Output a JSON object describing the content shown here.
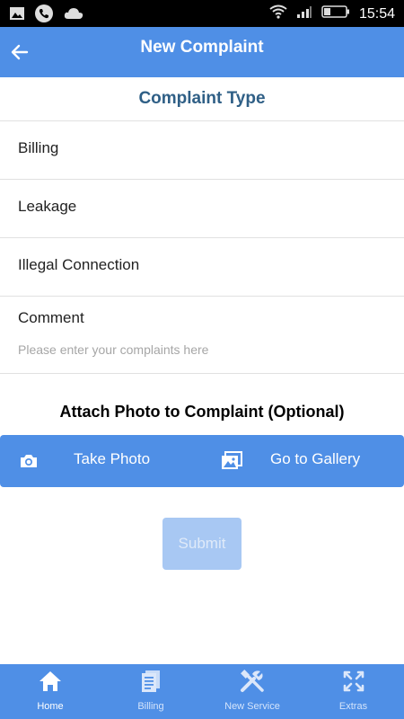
{
  "status": {
    "time": "15:54"
  },
  "appbar": {
    "title": "New Complaint"
  },
  "section": {
    "title": "Complaint Type"
  },
  "types": [
    "Billing",
    "Leakage",
    "Illegal Connection"
  ],
  "comment": {
    "label": "Comment",
    "placeholder": "Please enter your complaints here",
    "value": ""
  },
  "attach": {
    "title": "Attach Photo to Complaint (Optional)",
    "take_photo": "Take Photo",
    "gallery": "Go to Gallery"
  },
  "submit": {
    "label": "Submit"
  },
  "nav": {
    "home": "Home",
    "billing": "Billing",
    "new_service": "New Service",
    "extras": "Extras",
    "active": "Home"
  },
  "colors": {
    "primary": "#4f8fe6",
    "heading": "#2f5f86",
    "submit_disabled": "#a8c8f3"
  },
  "icons": {
    "status": [
      "gallery-icon",
      "phone-icon",
      "cloud-icon",
      "wifi-icon",
      "signal-icon",
      "battery-icon"
    ],
    "appbar": "back-arrow-icon",
    "attach": [
      "camera-icon",
      "gallery-icon"
    ],
    "nav": [
      "home-icon",
      "document-icon",
      "tools-icon",
      "expand-icon"
    ]
  }
}
